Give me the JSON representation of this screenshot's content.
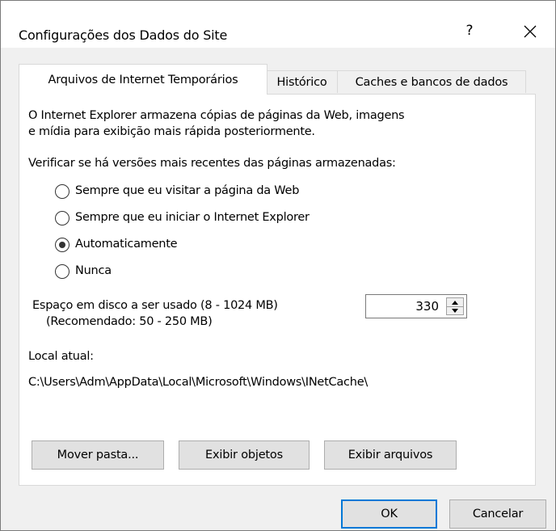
{
  "window": {
    "title": "Configurações dos Dados do Site",
    "help": "?",
    "close_icon": "close-icon"
  },
  "tabs": [
    {
      "label": "Arquivos de Internet Temporários",
      "active": true
    },
    {
      "label": "Histórico",
      "active": false
    },
    {
      "label": "Caches e bancos de dados",
      "active": false
    }
  ],
  "panel": {
    "description_line1": "O Internet Explorer armazena cópias de páginas da Web, imagens",
    "description_line2": "e mídia para exibição mais rápida posteriormente.",
    "check_label": "Verificar se há versões mais recentes das páginas armazenadas:",
    "options": [
      {
        "label": "Sempre que eu visitar a página da Web",
        "checked": false
      },
      {
        "label": "Sempre que eu iniciar o Internet Explorer",
        "checked": false
      },
      {
        "label": "Automaticamente",
        "checked": true
      },
      {
        "label": "Nunca",
        "checked": false
      }
    ],
    "disk_label_line1": "Espaço em disco a ser usado (8 - 1024 MB)",
    "disk_label_line2": "(Recomendado: 50 - 250 MB)",
    "disk_value": "330",
    "location_label": "Local atual:",
    "location_path": "C:\\Users\\Adm\\AppData\\Local\\Microsoft\\Windows\\INetCache\\",
    "buttons": {
      "move": "Mover pasta...",
      "view_objects": "Exibir objetos",
      "view_files": "Exibir arquivos"
    }
  },
  "footer": {
    "ok": "OK",
    "cancel": "Cancelar"
  }
}
